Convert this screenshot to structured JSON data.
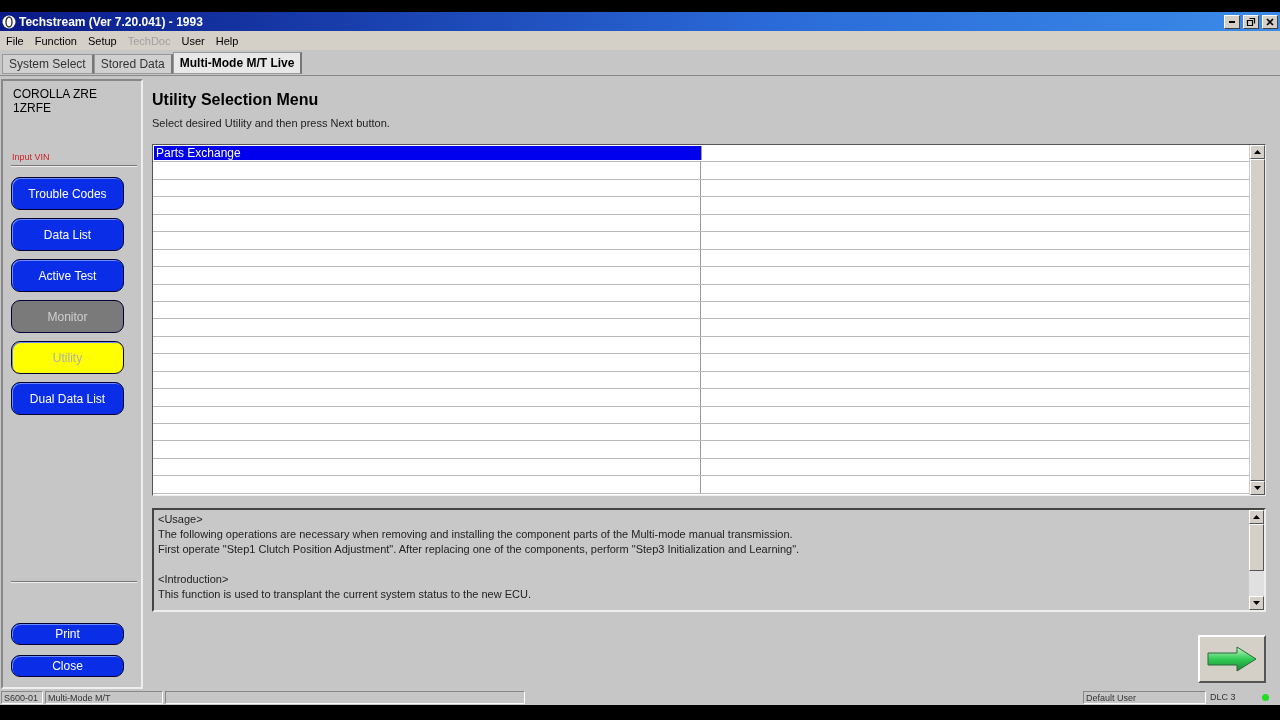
{
  "window": {
    "title": "Techstream (Ver 7.20.041) - 1993"
  },
  "menu": [
    {
      "label": "File",
      "disabled": false
    },
    {
      "label": "Function",
      "disabled": false
    },
    {
      "label": "Setup",
      "disabled": false
    },
    {
      "label": "TechDoc",
      "disabled": true
    },
    {
      "label": "User",
      "disabled": false
    },
    {
      "label": "Help",
      "disabled": false
    }
  ],
  "tabs": [
    {
      "label": "System Select",
      "selected": false
    },
    {
      "label": "Stored Data",
      "selected": false
    },
    {
      "label": "Multi-Mode M/T Live",
      "selected": true
    }
  ],
  "sidebar": {
    "vehicle": [
      "COROLLA ZRE",
      "1ZRFE"
    ],
    "vin_link": "Input VIN",
    "items": [
      {
        "label": "Trouble Codes",
        "selected": false,
        "disabled": false
      },
      {
        "label": "Data List",
        "selected": false,
        "disabled": false
      },
      {
        "label": "Active Test",
        "selected": false,
        "disabled": false
      },
      {
        "label": "Monitor",
        "selected": false,
        "disabled": true
      },
      {
        "label": "Utility",
        "selected": true,
        "disabled": false
      },
      {
        "label": "Dual Data List",
        "selected": false,
        "disabled": false
      }
    ],
    "bottom_buttons": [
      "Print",
      "Close"
    ]
  },
  "main": {
    "title": "Utility Selection Menu",
    "instruction": "Select desired Utility and then press Next button.",
    "table": {
      "rows": [
        {
          "cells": [
            "Parts Exchange"
          ],
          "selected": true
        }
      ]
    },
    "description": [
      [
        "<Usage>",
        "The following operations are necessary when removing and installing the component parts of the Multi-mode manual transmission.",
        "First operate \"Step1 Clutch Position Adjustment\". After replacing one of the components, perform \"Step3 Initialization and Learning\"."
      ],
      [
        "<Introduction>",
        "This function is used to transplant the current system status to the new ECU."
      ]
    ]
  },
  "status_bar": {
    "code": "S600-01",
    "mode": "Multi-Mode M/T",
    "user": "Default User",
    "connection": "DLC 3",
    "connected": true
  }
}
